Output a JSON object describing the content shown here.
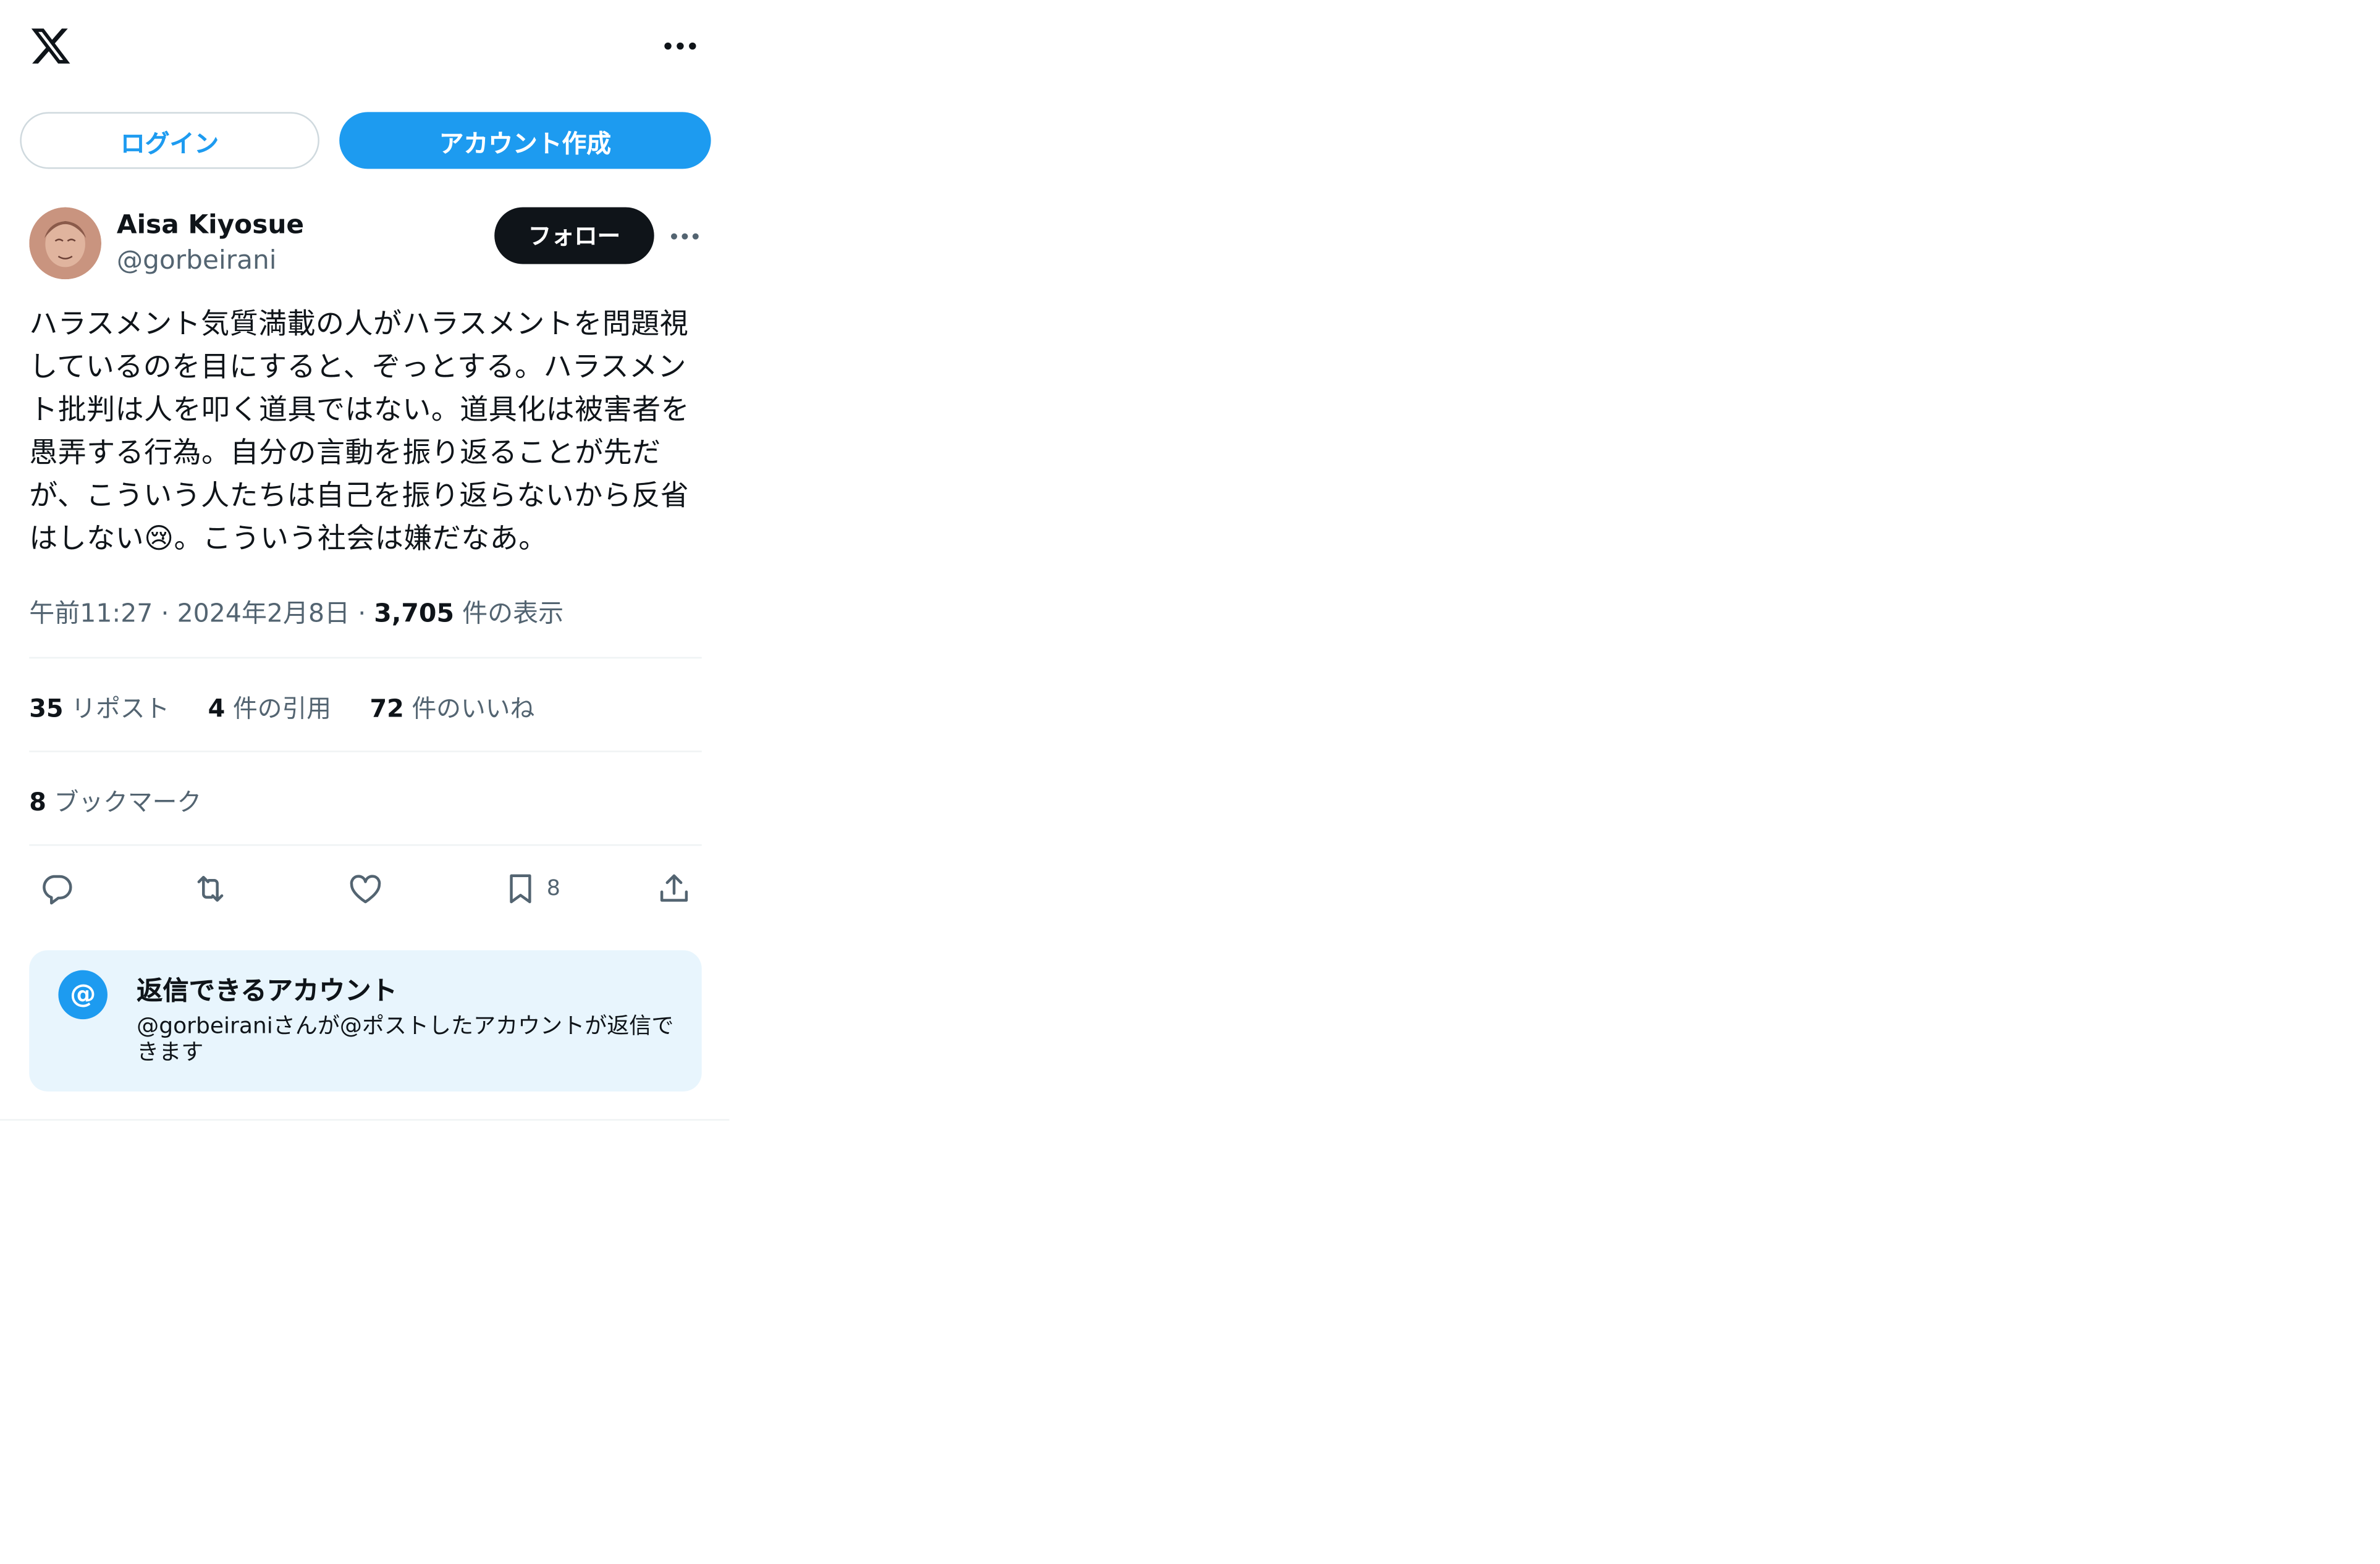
{
  "header": {
    "brand": "X",
    "more_label": "..."
  },
  "auth": {
    "login_label": "ログイン",
    "signup_label": "アカウント作成"
  },
  "tweet": {
    "author": {
      "name": "Aisa Kiyosue",
      "handle": "@gorbeirani"
    },
    "follow_label": "フォロー",
    "text": "ハラスメント気質満載の人がハラスメントを問題視しているのを目にすると、ぞっとする。ハラスメント批判は人を叩く道具ではない。道具化は被害者を愚弄する行為。自分の言動を振り返ることが先だが、こういう人たちは自己を振り返らないから反省はしない😢。こういう社会は嫌だなあ。",
    "time": "午前11:27",
    "date": "2024年2月8日",
    "separator": "·",
    "views_count": "3,705",
    "views_label": "件の表示",
    "stats": {
      "reposts_count": "35",
      "reposts_label": "リポスト",
      "quotes_count": "4",
      "quotes_label": "件の引用",
      "likes_count": "72",
      "likes_label": "件のいいね"
    },
    "bookmarks": {
      "count": "8",
      "label": "ブックマーク"
    },
    "actions": {
      "bookmark_count": "8"
    }
  },
  "reply_settings": {
    "icon_symbol": "@",
    "title": "返信できるアカウント",
    "description": "@gorbeiraniさんが@ポストしたアカウントが返信できます"
  },
  "colors": {
    "accent": "#1d9bf0",
    "text": "#0f1419",
    "secondary": "#536471",
    "follow_bg": "#0f1419",
    "reply_box_bg": "#e8f5fd"
  }
}
